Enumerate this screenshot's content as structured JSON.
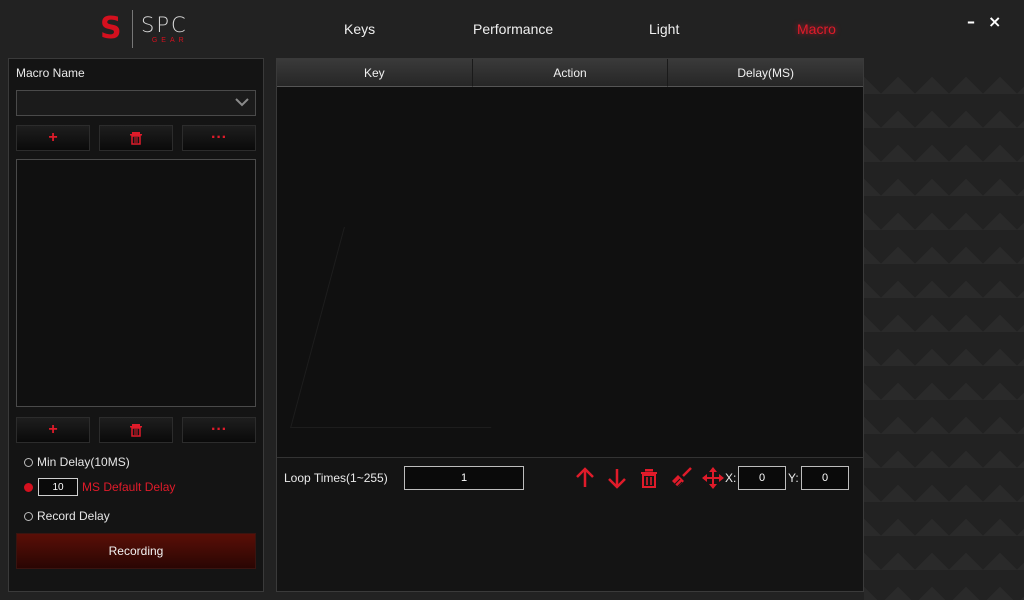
{
  "header": {
    "logo_brand": "SPC",
    "logo_sub": "GEAR",
    "logo_mark": "S",
    "tabs": [
      {
        "label": "Keys"
      },
      {
        "label": "Performance"
      },
      {
        "label": "Light"
      },
      {
        "label": "Macro"
      }
    ],
    "active_tab": "Macro",
    "minimize_glyph": "–",
    "close_glyph": "×"
  },
  "left": {
    "macro_name_label": "Macro Name",
    "macro_select_value": "",
    "top_buttons": [
      "+",
      "",
      "···"
    ],
    "bottom_buttons": [
      "+",
      "",
      "···"
    ],
    "options": {
      "min_delay": "Min Delay(10MS)",
      "default_delay_value": "10",
      "default_delay_label": "MS Default Delay",
      "record_delay": "Record Delay",
      "selected": "default_delay"
    },
    "recording_label": "Recording"
  },
  "main": {
    "columns": [
      "Key",
      "Action",
      "Delay(MS)"
    ],
    "rows": [],
    "loop_label": "Loop Times(1~255)",
    "loop_value": "1",
    "x_label": "X:",
    "x_value": "0",
    "y_label": "Y:",
    "y_value": "0",
    "tools": [
      "arrow-up-icon",
      "arrow-down-icon",
      "trash-icon",
      "clear-brush-icon",
      "move-icon"
    ]
  },
  "colors": {
    "accent": "#e01b2a",
    "background": "#222222",
    "panel": "#141414",
    "recording": "#4a0c06"
  }
}
